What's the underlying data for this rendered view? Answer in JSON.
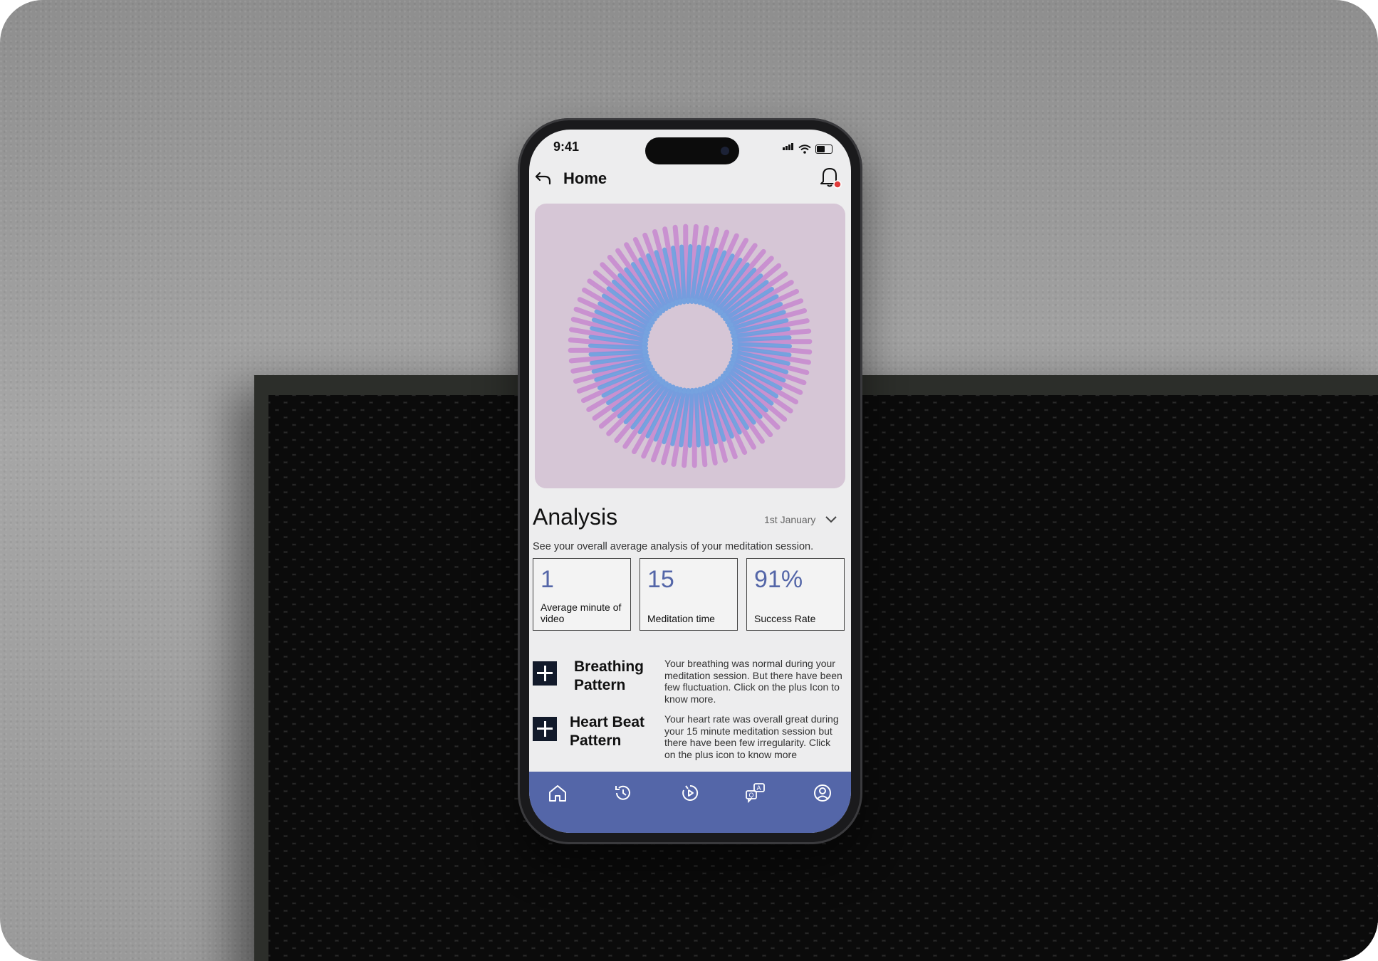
{
  "status": {
    "time": "9:41"
  },
  "header": {
    "title": "Home"
  },
  "analysis": {
    "title": "Analysis",
    "date": "1st January",
    "description": "See your overall average analysis of your meditation session."
  },
  "stats": [
    {
      "value": "1",
      "label": "Average minute of video"
    },
    {
      "value": "15",
      "label": "Meditation time"
    },
    {
      "value": "91%",
      "label": "Success Rate"
    }
  ],
  "patterns": [
    {
      "title": "Breathing Pattern",
      "description": "Your breathing was normal during your meditation session. But there have been few fluctuation. Click on the plus Icon to know more."
    },
    {
      "title": "Heart Beat Pattern",
      "description": "Your heart rate was overall great during your 15 minute meditation session but there have been few irregularity. Click on the plus icon to know more"
    }
  ],
  "tabs": [
    {
      "icon": "home-icon"
    },
    {
      "icon": "history-icon"
    },
    {
      "icon": "progress-icon"
    },
    {
      "icon": "chat-qa-icon"
    },
    {
      "icon": "profile-icon"
    }
  ],
  "colors": {
    "accent": "#5466a8",
    "notification": "#e03a3a",
    "hero_bg": "#d6c6d6",
    "petal_pink": "#c98fd0",
    "petal_blue": "#6c9fe0"
  }
}
